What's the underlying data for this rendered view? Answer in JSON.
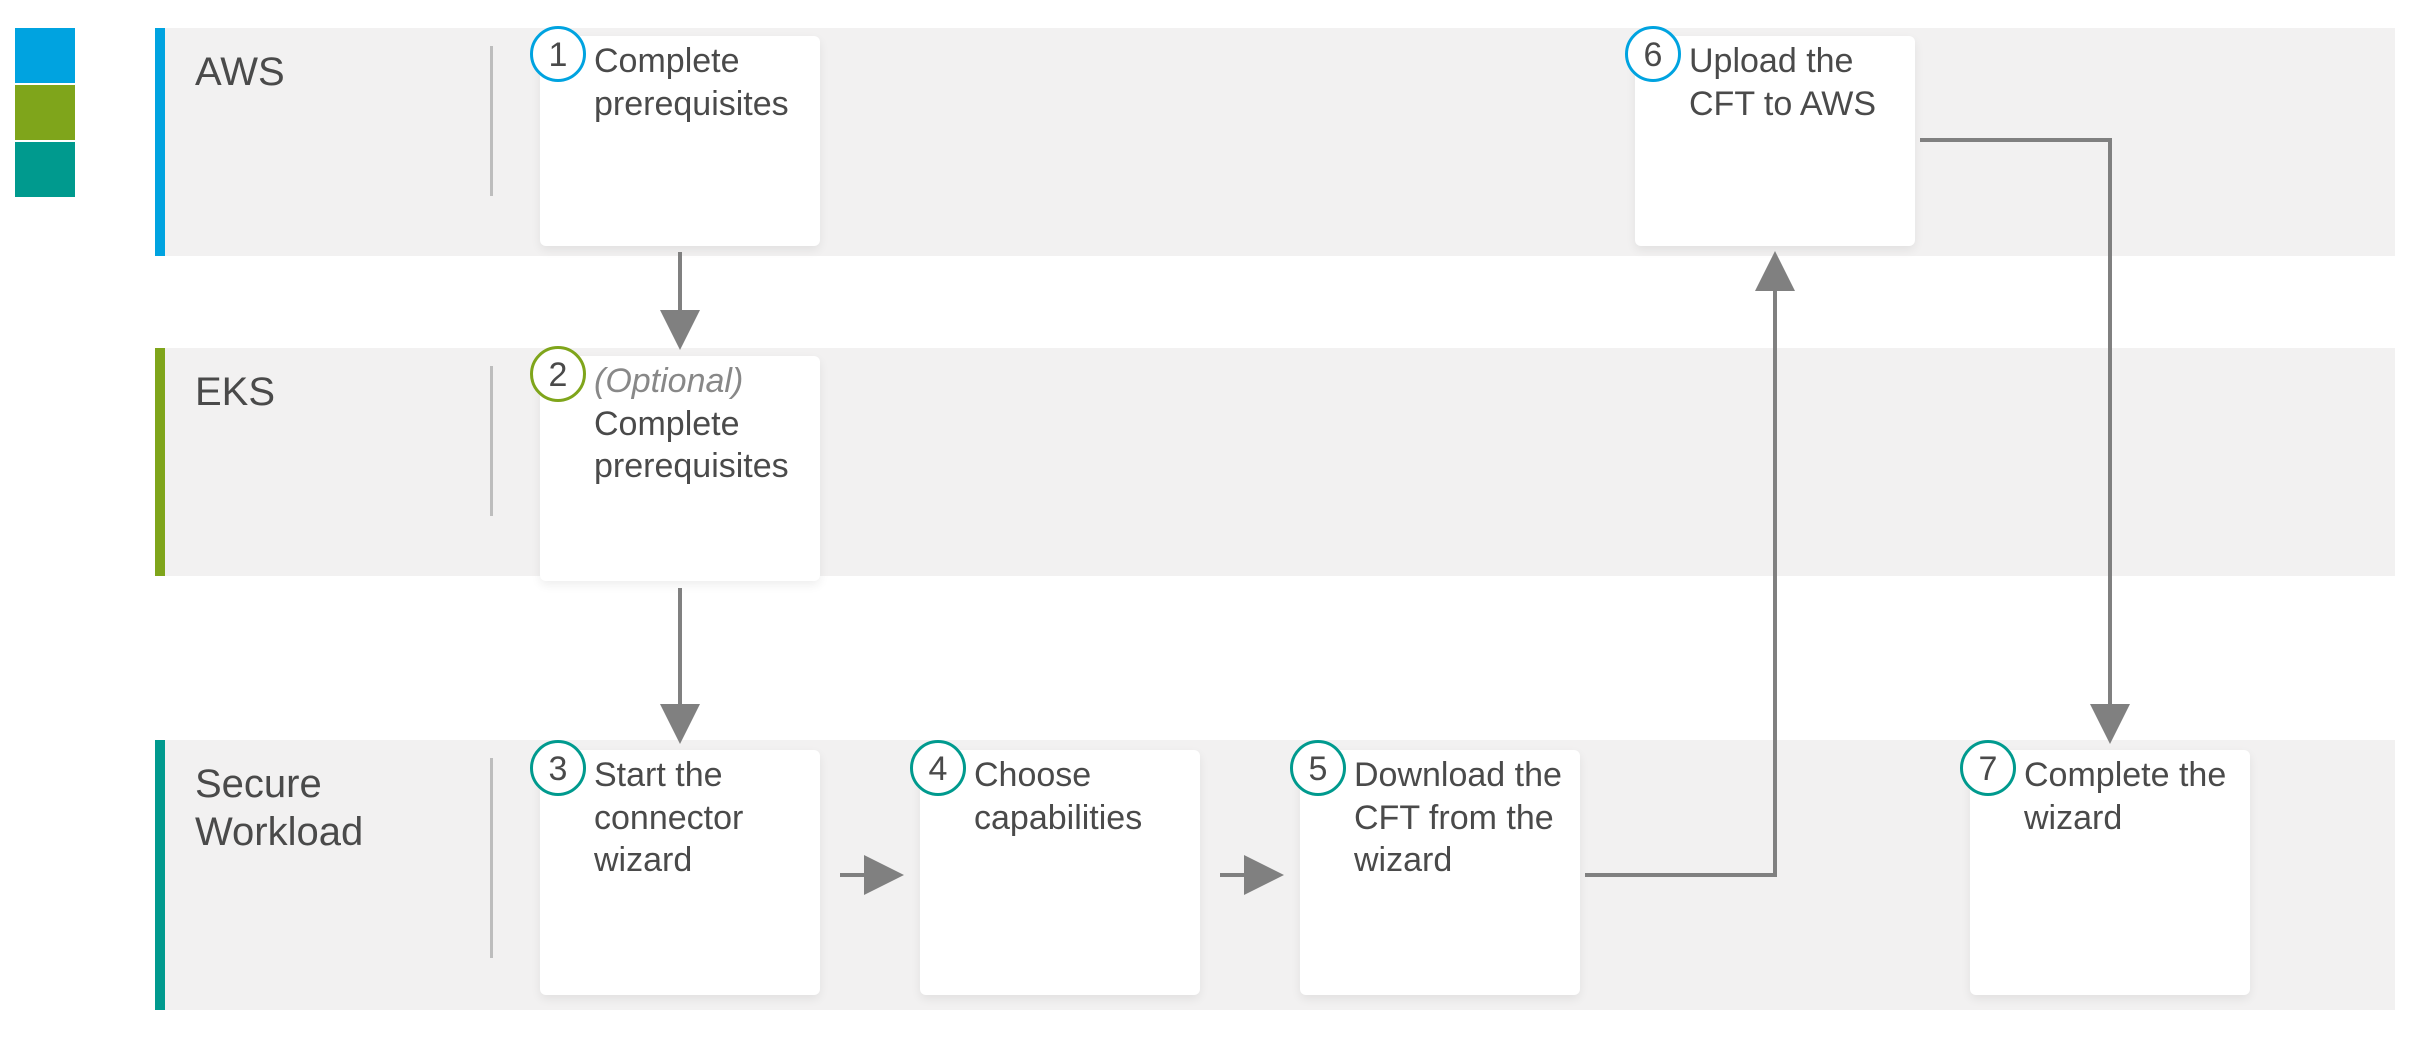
{
  "lanes": {
    "aws": {
      "label": "AWS",
      "accent": "#00a3e0"
    },
    "eks": {
      "label": "EKS",
      "accent": "#7fa51b"
    },
    "sw": {
      "label": "Secure\nWorkload",
      "accent": "#009a8e"
    }
  },
  "steps": {
    "s1": {
      "num": "1",
      "text": "Complete prerequisites",
      "ring": "#00a3e0"
    },
    "s2": {
      "num": "2",
      "optional": "(Optional)",
      "text": "Complete prerequisites",
      "ring": "#7fa51b"
    },
    "s3": {
      "num": "3",
      "text": "Start the connector wizard",
      "ring": "#009a8e"
    },
    "s4": {
      "num": "4",
      "text": "Choose capabilities",
      "ring": "#009a8e"
    },
    "s5": {
      "num": "5",
      "text": "Download the CFT from the wizard",
      "ring": "#009a8e"
    },
    "s6": {
      "num": "6",
      "text": "Upload the CFT to AWS",
      "ring": "#00a3e0"
    },
    "s7": {
      "num": "7",
      "text": "Complete the wizard",
      "ring": "#009a8e"
    }
  },
  "legend": {
    "c1": "#00a3e0",
    "c2": "#7fa51b",
    "c3": "#009a8e"
  }
}
